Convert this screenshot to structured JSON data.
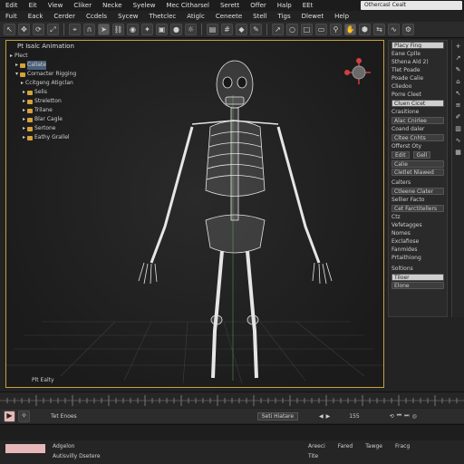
{
  "menubar1": [
    "Edit",
    "Eit",
    "View",
    "Cliker",
    "Necke",
    "Syelew",
    "Mec Citharsel",
    "Serett",
    "Offer",
    "Halp",
    "EEt"
  ],
  "menubar2": [
    "Fuit",
    "Eack",
    "Cerder",
    "Ccdels",
    "Sycew",
    "Thetclec",
    "Atiglc",
    "Ceneete",
    "Stell",
    "Tigs",
    "Dlewet",
    "Help"
  ],
  "title_input": "Othercasl Cealt",
  "viewport": {
    "label": "Pt Isalc Animation",
    "bottom_label": "Plt Ealty"
  },
  "outliner": {
    "root": "Plect",
    "items": [
      "Callate",
      "Cornacter Rigging",
      "Ccitgeng Atigclan",
      "Selis",
      "Streletton",
      "Trilane",
      "Blar Cagle",
      "Sertone",
      "Eathy Grallel"
    ]
  },
  "right_panel": {
    "header_field": "Placy Fing",
    "rows": [
      "Eane Cplle",
      "Sthena Ald 2)",
      "Tlet Poade",
      "Poade Calie",
      "Cliedoo",
      "Porre Cleet"
    ],
    "field_light": "Cluen Cicet",
    "section_controls": "Crasitione",
    "field2": "Alac Cnirlee",
    "row2": "Coand daler",
    "field3": "Cltee Cnhts",
    "row3": "Offerst Oty",
    "btns": [
      "Edit",
      "Gell"
    ],
    "field4": "Calie",
    "field5": "Cletlet Nlawed",
    "section2": "Calters",
    "field6": "Ctleene Clater",
    "row4": "Sellier Facto",
    "field7": "Cet Farctitellers",
    "row5": "Ctz",
    "row6": "Vefetagges",
    "row7": "Nomes",
    "row8": "Exclafiose",
    "row9": "Fanmides",
    "row10": "Prtaithiong",
    "section3": "Soltions",
    "field8": "Tiloer",
    "field9": "Elone"
  },
  "timeline": {
    "label": "Tet Enoes",
    "dropdown": "Seti Hiatare",
    "frame": "155"
  },
  "status": {
    "item1": "Adgelon",
    "item2": "Autisvilly Dsetere",
    "right_items": [
      "Areeci",
      "Fared",
      "Tawge",
      "Fracg"
    ],
    "tool": "Tite"
  },
  "colors": {
    "accent": "#c9a13a",
    "selection": "#4a5f7a",
    "record": "#e8b8b8"
  }
}
